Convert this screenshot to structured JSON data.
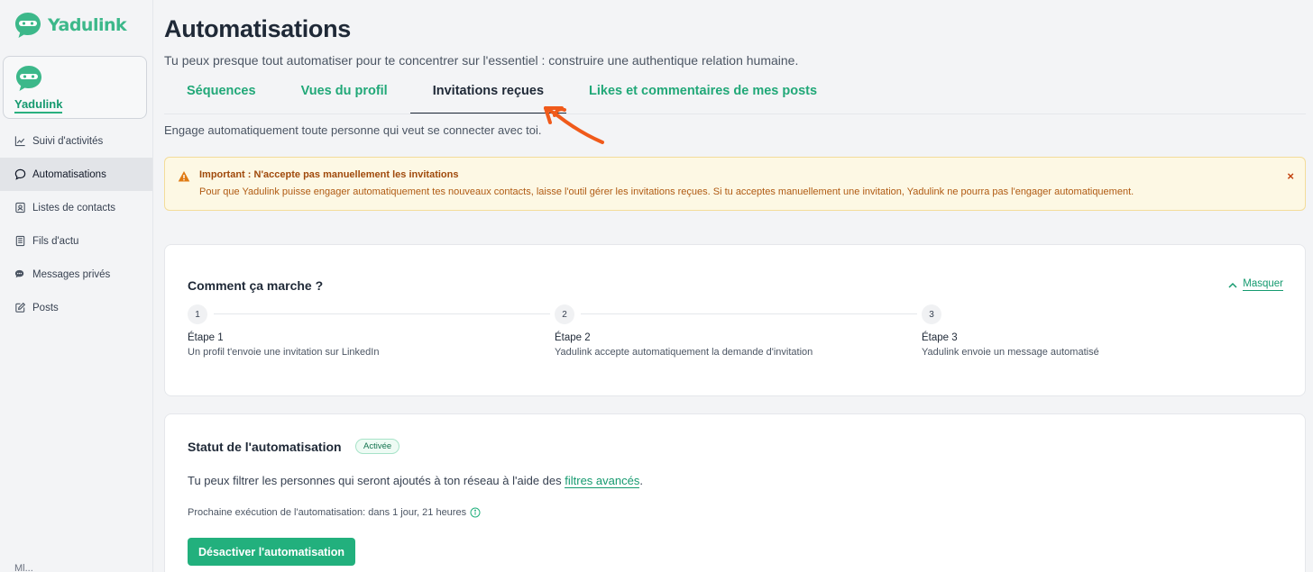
{
  "brand": {
    "name": "Yadulink",
    "color": "#3cb88a"
  },
  "account": {
    "name": "Yadulink"
  },
  "sidebar": {
    "items": [
      {
        "label": "Suivi d'activités",
        "icon": "chart-line-icon"
      },
      {
        "label": "Automatisations",
        "icon": "chat-bubble-icon",
        "active": true
      },
      {
        "label": "Listes de contacts",
        "icon": "contact-card-icon"
      },
      {
        "label": "Fils d'actu",
        "icon": "newspaper-icon"
      },
      {
        "label": "Messages privés",
        "icon": "messages-icon"
      },
      {
        "label": "Posts",
        "icon": "edit-icon"
      }
    ],
    "bottom_partial": "Ml..."
  },
  "header": {
    "title": "Automatisations",
    "subtitle": "Tu peux presque tout automatiser pour te concentrer sur l'essentiel : construire une authentique relation humaine."
  },
  "tabs": [
    {
      "label": "Séquences"
    },
    {
      "label": "Vues du profil"
    },
    {
      "label": "Invitations reçues",
      "active": true
    },
    {
      "label": "Likes et commentaires de mes posts"
    }
  ],
  "tab_description": "Engage automatiquement toute personne qui veut se connecter avec toi.",
  "alert": {
    "title": "Important : N'accepte pas manuellement les invitations",
    "text": "Pour que Yadulink puisse engager automatiquement tes nouveaux contacts, laisse l'outil gérer les invitations reçues. Si tu acceptes manuellement une invitation, Yadulink ne pourra pas l'engager automatiquement.",
    "close": "×"
  },
  "how_it_works": {
    "title": "Comment ça marche ?",
    "toggle_label": "Masquer",
    "steps": [
      {
        "num": "1",
        "title": "Étape 1",
        "desc": "Un profil t'envoie une invitation sur LinkedIn"
      },
      {
        "num": "2",
        "title": "Étape 2",
        "desc": "Yadulink accepte automatiquement la demande d'invitation"
      },
      {
        "num": "3",
        "title": "Étape 3",
        "desc": "Yadulink envoie un message automatisé"
      }
    ]
  },
  "status": {
    "title": "Statut de l'automatisation",
    "badge": "Activée",
    "filter_text_before": "Tu peux filtrer les personnes qui seront ajoutés à ton réseau à l'aide des ",
    "filter_link": "filtres avancés",
    "filter_text_after": ".",
    "next_run": "Prochaine exécution de l'automatisation: dans 1 jour, 21 heures",
    "button": "Désactiver l'automatisation"
  }
}
